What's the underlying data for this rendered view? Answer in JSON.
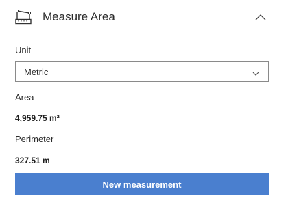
{
  "header": {
    "title": "Measure Area",
    "icon": "measure-area-icon",
    "collapse_icon": "chevron-up-icon"
  },
  "unit": {
    "label": "Unit",
    "selected": "Metric",
    "icon": "chevron-down-icon"
  },
  "results": {
    "area_label": "Area",
    "area_value": "4,959.75 m²",
    "perimeter_label": "Perimeter",
    "perimeter_value": "327.51 m"
  },
  "actions": {
    "new_measurement_label": "New measurement"
  },
  "colors": {
    "primary_button": "#4a7fcf",
    "text": "#2b2b2b",
    "border": "#8a8a8a"
  }
}
